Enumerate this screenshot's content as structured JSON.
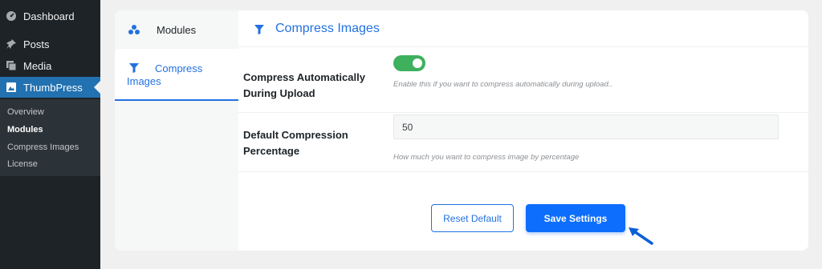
{
  "sidebar": {
    "items": [
      {
        "label": "Dashboard",
        "icon": "dashboard-icon"
      },
      {
        "label": "Posts",
        "icon": "pin-icon"
      },
      {
        "label": "Media",
        "icon": "media-icon"
      },
      {
        "label": "ThumbPress",
        "icon": "thumbpress-icon"
      }
    ],
    "submenu": [
      {
        "label": "Overview"
      },
      {
        "label": "Modules"
      },
      {
        "label": "Compress Images"
      },
      {
        "label": "License"
      }
    ]
  },
  "tabs": [
    {
      "label": "Modules",
      "icon": "modules-icon"
    },
    {
      "label": "Compress Images",
      "icon": "filter-icon"
    }
  ],
  "header": {
    "title": "Compress Images",
    "icon": "filter-icon"
  },
  "settings": {
    "auto": {
      "label": "Compress Automatically During Upload",
      "help": "Enable this if you want to compress automatically during upload..",
      "enabled": true
    },
    "percentage": {
      "label": "Default Compression Percentage",
      "value": "50",
      "help": "How much you want to compress image by percentage"
    }
  },
  "buttons": {
    "reset": "Reset Default",
    "save": "Save Settings"
  },
  "colors": {
    "accent": "#2271e1",
    "primary": "#0d6efd",
    "toggle_on": "#3eb05e",
    "wp_blue": "#2271b1",
    "wp_dark": "#1d2327"
  }
}
